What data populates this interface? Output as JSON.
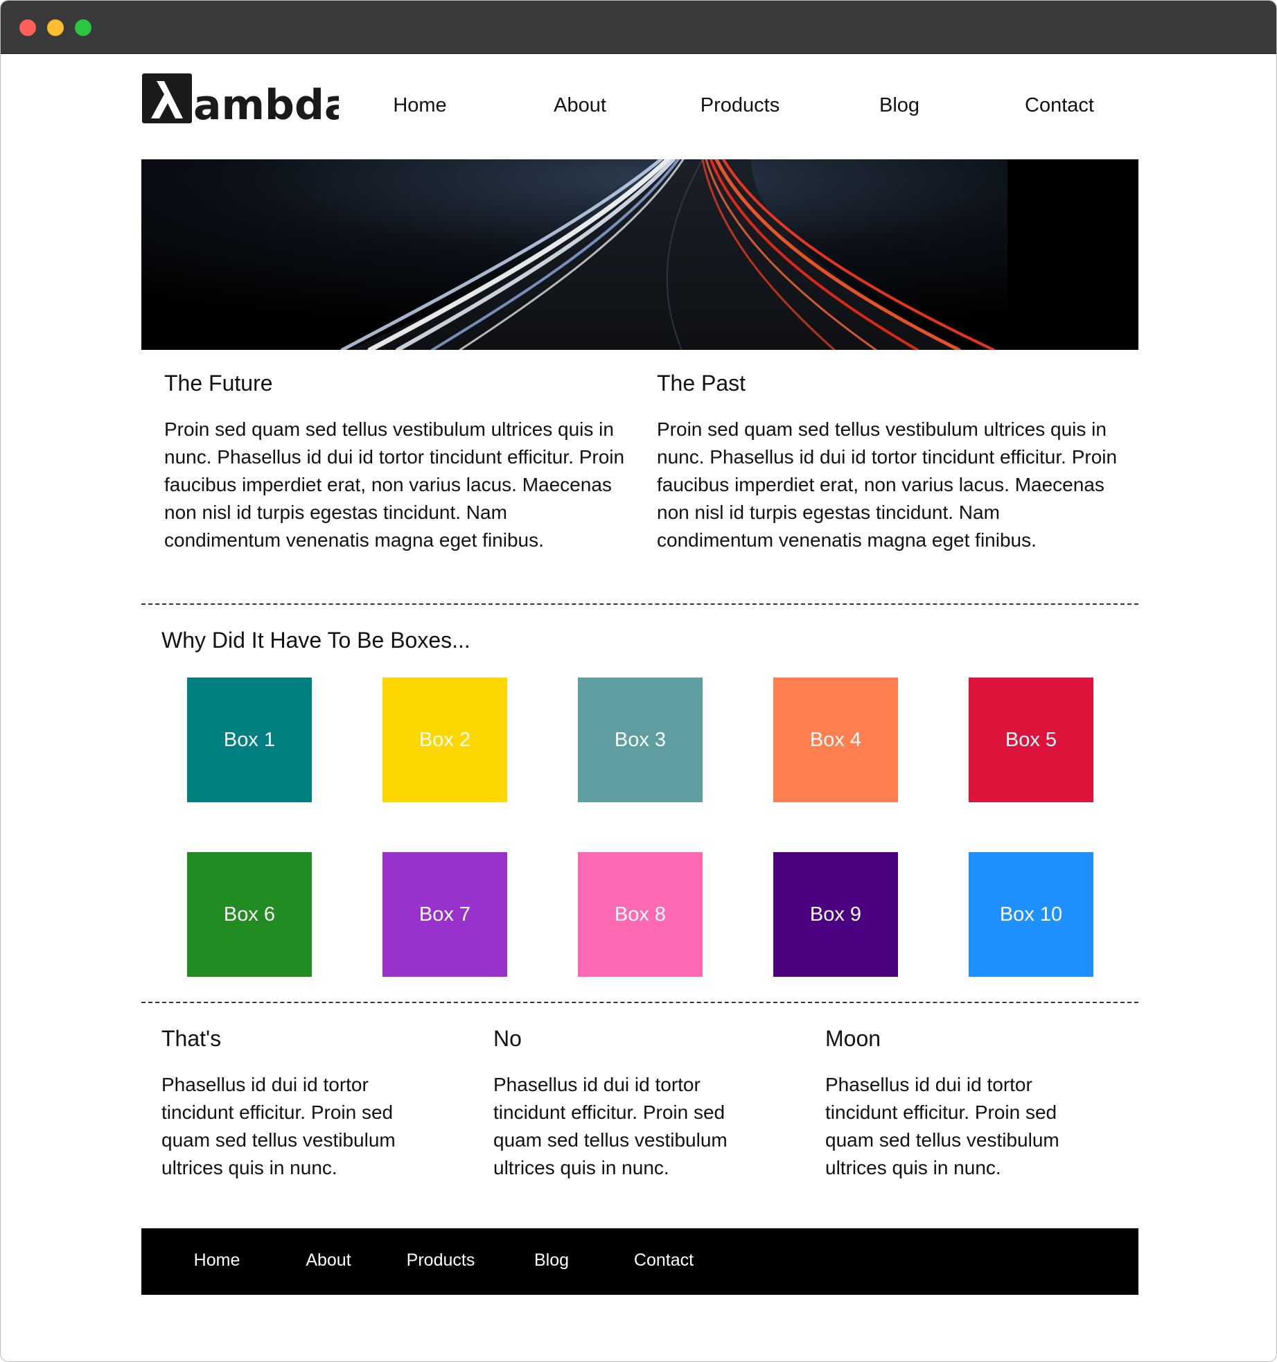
{
  "window": {
    "controls": [
      "close",
      "minimize",
      "maximize"
    ]
  },
  "logo": {
    "text": "λambda"
  },
  "nav": {
    "items": [
      "Home",
      "About",
      "Products",
      "Blog",
      "Contact"
    ]
  },
  "hero": {
    "icon": "highway-light-trails-image"
  },
  "sections": [
    {
      "title": "The Future",
      "body": "Proin sed quam sed tellus vestibulum ultrices quis in nunc. Phasellus id dui id tortor tincidunt efficitur. Proin faucibus imperdiet erat, non varius lacus. Maecenas non nisl id turpis egestas tincidunt. Nam condimentum venenatis magna eget finibus."
    },
    {
      "title": "The Past",
      "body": "Proin sed quam sed tellus vestibulum ultrices quis in nunc. Phasellus id dui id tortor tincidunt efficitur. Proin faucibus imperdiet erat, non varius lacus. Maecenas non nisl id turpis egestas tincidunt. Nam condimentum venenatis magna eget finibus."
    }
  ],
  "boxes": {
    "title": "Why Did It Have To Be Boxes...",
    "items": [
      {
        "label": "Box 1",
        "color": "#008080"
      },
      {
        "label": "Box 2",
        "color": "#FFD700"
      },
      {
        "label": "Box 3",
        "color": "#5F9EA0"
      },
      {
        "label": "Box 4",
        "color": "#FF7F50"
      },
      {
        "label": "Box 5",
        "color": "#DC143C"
      },
      {
        "label": "Box 6",
        "color": "#228B22"
      },
      {
        "label": "Box 7",
        "color": "#9932CC"
      },
      {
        "label": "Box 8",
        "color": "#FF69B4"
      },
      {
        "label": "Box 9",
        "color": "#4B0082"
      },
      {
        "label": "Box 10",
        "color": "#1E90FF"
      }
    ]
  },
  "bottom_sections": [
    {
      "title": "That's",
      "body": "Phasellus id dui id tortor tincidunt efficitur. Proin sed quam sed tellus vestibulum ultrices quis in nunc."
    },
    {
      "title": "No",
      "body": "Phasellus id dui id tortor tincidunt efficitur. Proin sed quam sed tellus vestibulum ultrices quis in nunc."
    },
    {
      "title": "Moon",
      "body": "Phasellus id dui id tortor tincidunt efficitur. Proin sed quam sed tellus vestibulum ultrices quis in nunc."
    }
  ],
  "footer": {
    "items": [
      "Home",
      "About",
      "Products",
      "Blog",
      "Contact"
    ]
  }
}
